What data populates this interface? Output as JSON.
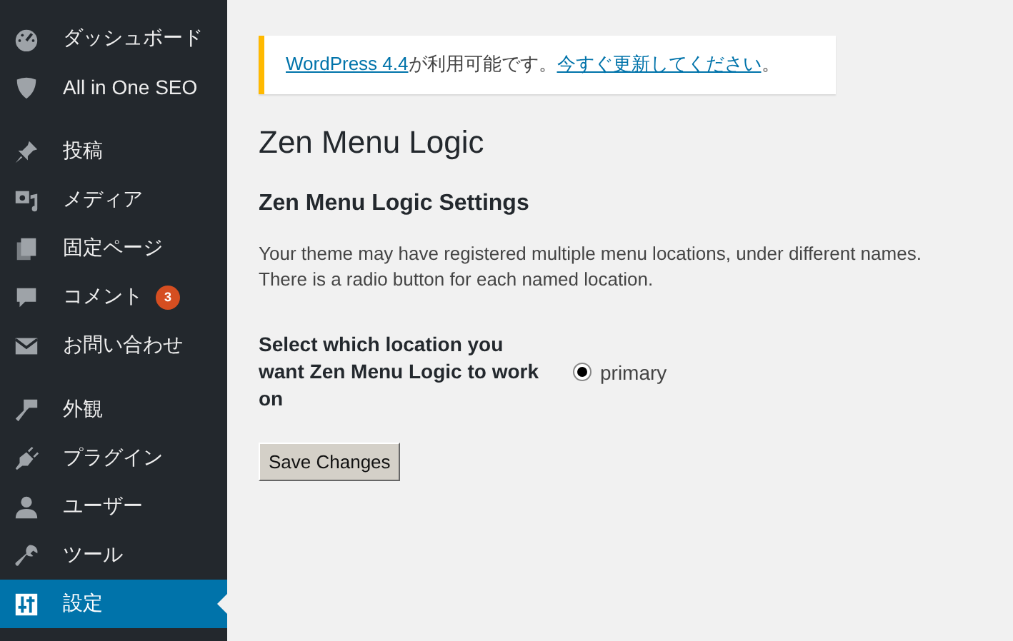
{
  "sidebar": {
    "groups": [
      [
        {
          "label": "ダッシュボード",
          "kind": "dashboard",
          "selected": false
        },
        {
          "label": "All in One SEO",
          "kind": "shield",
          "selected": false
        }
      ],
      [
        {
          "label": "投稿",
          "kind": "pin",
          "selected": false
        },
        {
          "label": "メディア",
          "kind": "media",
          "selected": false
        },
        {
          "label": "固定ページ",
          "kind": "pages",
          "selected": false
        },
        {
          "label": "コメント",
          "kind": "comment",
          "selected": false,
          "badge": "3"
        },
        {
          "label": "お問い合わせ",
          "kind": "mail",
          "selected": false
        }
      ],
      [
        {
          "label": "外観",
          "kind": "brush",
          "selected": false
        },
        {
          "label": "プラグイン",
          "kind": "plug",
          "selected": false
        },
        {
          "label": "ユーザー",
          "kind": "user",
          "selected": false
        },
        {
          "label": "ツール",
          "kind": "wrench",
          "selected": false
        },
        {
          "label": "設定",
          "kind": "settings",
          "selected": true
        }
      ]
    ]
  },
  "notice": {
    "parts": [
      {
        "text": "WordPress 4.4",
        "link": true
      },
      {
        "text": "が利用可能です。",
        "link": false
      },
      {
        "text": "今すぐ更新してください",
        "link": true
      },
      {
        "text": "。",
        "link": false
      }
    ]
  },
  "page_title": "Zen Menu Logic",
  "section_title": "Zen Menu Logic Settings",
  "description": "Your theme may have registered multiple menu locations, under different names. There is a radio button for each named location.",
  "field": {
    "label": "Select which location you want Zen Menu Logic to work on",
    "options": [
      {
        "label": "primary",
        "selected": true
      }
    ]
  },
  "save_button": "Save Changes"
}
